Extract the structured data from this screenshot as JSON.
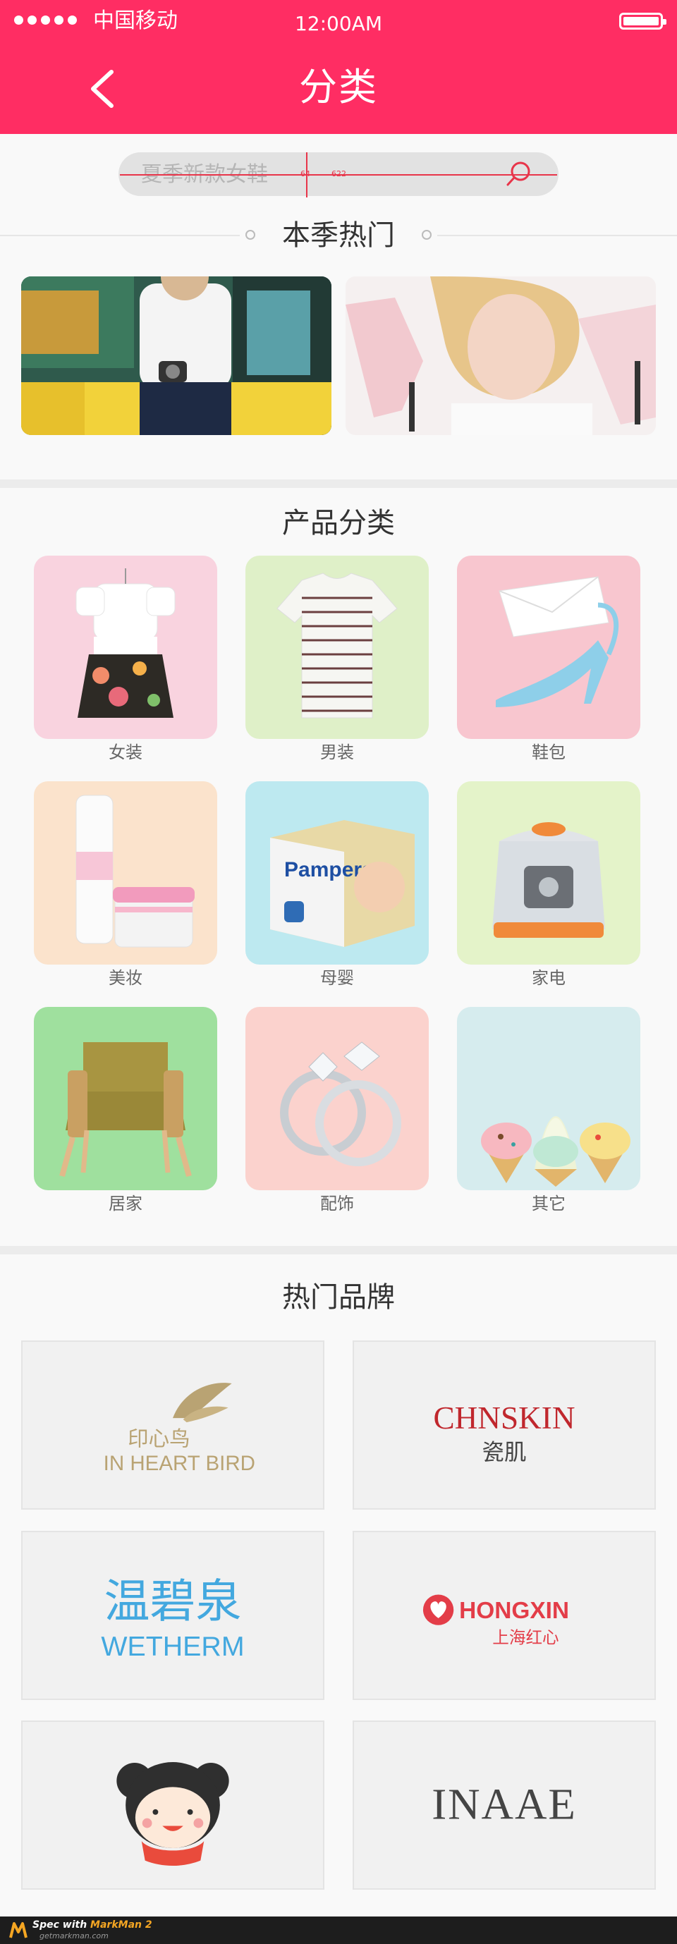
{
  "status_bar": {
    "carrier": "中国移动",
    "time": "12:00AM",
    "signal_dots": 5
  },
  "header": {
    "title": "分类",
    "back_icon": "chevron-left-icon"
  },
  "search": {
    "placeholder": "夏季新款女鞋",
    "icon": "search-icon",
    "spec_markers": [
      "64",
      "622"
    ]
  },
  "hot_season": {
    "title": "本季热门",
    "items": [
      {
        "subject": "man-with-camera-photo"
      },
      {
        "subject": "woman-with-sandals-photo"
      }
    ]
  },
  "categories": {
    "title": "产品分类",
    "items": [
      {
        "label": "女装",
        "bg": "#f9d3df",
        "icon": "dress-icon"
      },
      {
        "label": "男装",
        "bg": "#dff0c8",
        "icon": "striped-tshirt-icon"
      },
      {
        "label": "鞋包",
        "bg": "#f8c6cf",
        "icon": "high-heel-icon"
      },
      {
        "label": "美妆",
        "bg": "#fbe3cc",
        "icon": "cosmetics-icon"
      },
      {
        "label": "母婴",
        "bg": "#bde9f0",
        "icon": "diapers-box-icon"
      },
      {
        "label": "家电",
        "bg": "#e4f3c9",
        "icon": "rice-cooker-icon"
      },
      {
        "label": "居家",
        "bg": "#9fe09e",
        "icon": "armchair-icon"
      },
      {
        "label": "配饰",
        "bg": "#fbd2cd",
        "icon": "rings-icon"
      },
      {
        "label": "其它",
        "bg": "#d6ecee",
        "icon": "ice-cream-icon"
      }
    ]
  },
  "brands": {
    "title": "热门品牌",
    "items": [
      {
        "name": "印心鸟",
        "sub": "IN HEART BIRD",
        "color": "#b9a373"
      },
      {
        "name": "CHNSKIN",
        "sub": "瓷肌",
        "color": "#c0272d"
      },
      {
        "name": "温碧泉",
        "sub": "WETHERM",
        "color": "#43a8df"
      },
      {
        "name": "HONGXIN",
        "sub": "上海红心",
        "color": "#e33d48"
      },
      {
        "name": "",
        "sub": "",
        "icon": "bear-logo-icon",
        "color": "#2f2f2f"
      },
      {
        "name": "INAAE",
        "sub": "",
        "color": "#444444"
      }
    ]
  },
  "footer": {
    "badge_prefix": "Spec with",
    "badge_name": "MarkMan 2",
    "badge_url": "getmarkman.com"
  },
  "colors": {
    "accent": "#ff2d63",
    "page_bg": "#f6f6f6"
  }
}
